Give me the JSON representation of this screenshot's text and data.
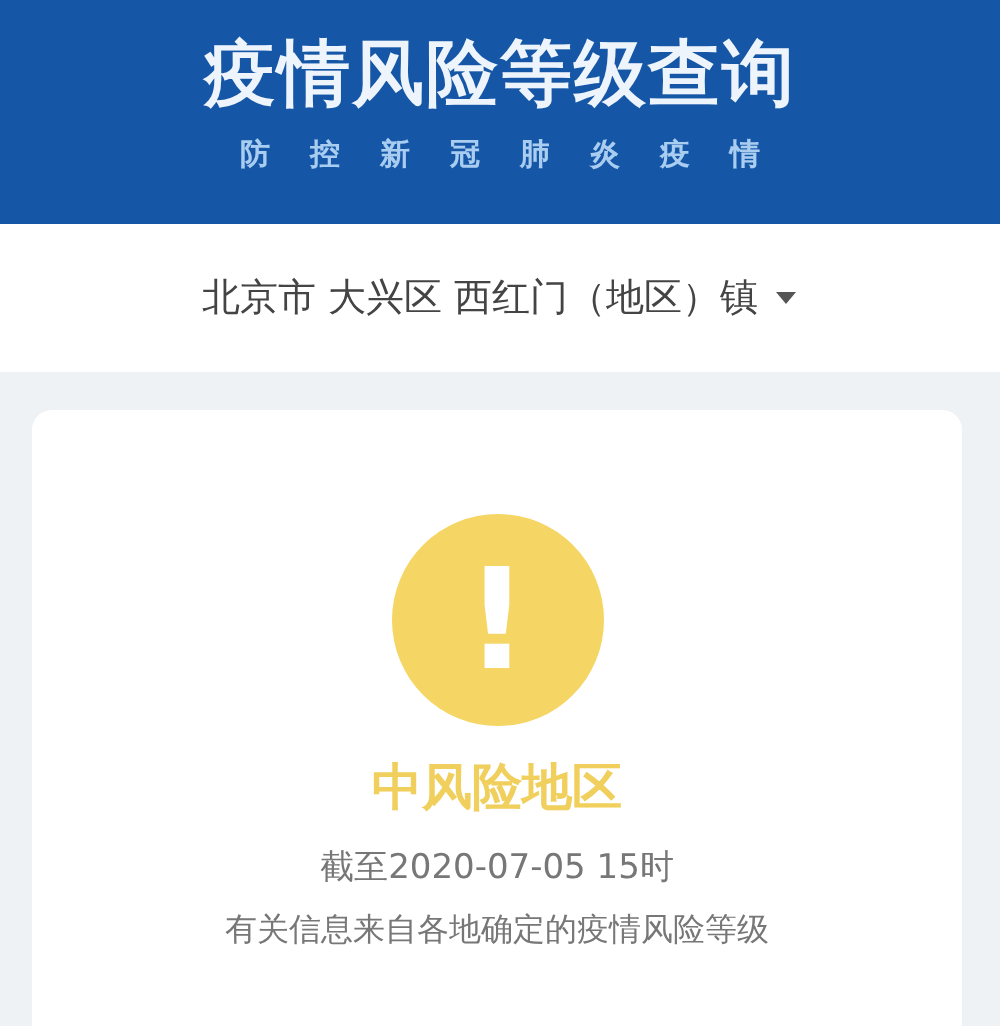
{
  "header": {
    "title": "疫情风险等级查询",
    "subtitle": [
      "防",
      "控",
      "新",
      "冠",
      "肺",
      "炎",
      "疫",
      "情"
    ]
  },
  "location": {
    "text": "北京市 大兴区 西红门（地区）镇"
  },
  "result": {
    "kind": "medium",
    "icon": "!",
    "label": "中风险地区",
    "date": "截至2020-07-05 15时",
    "note": "有关信息来自各地确定的疫情风险等级"
  }
}
